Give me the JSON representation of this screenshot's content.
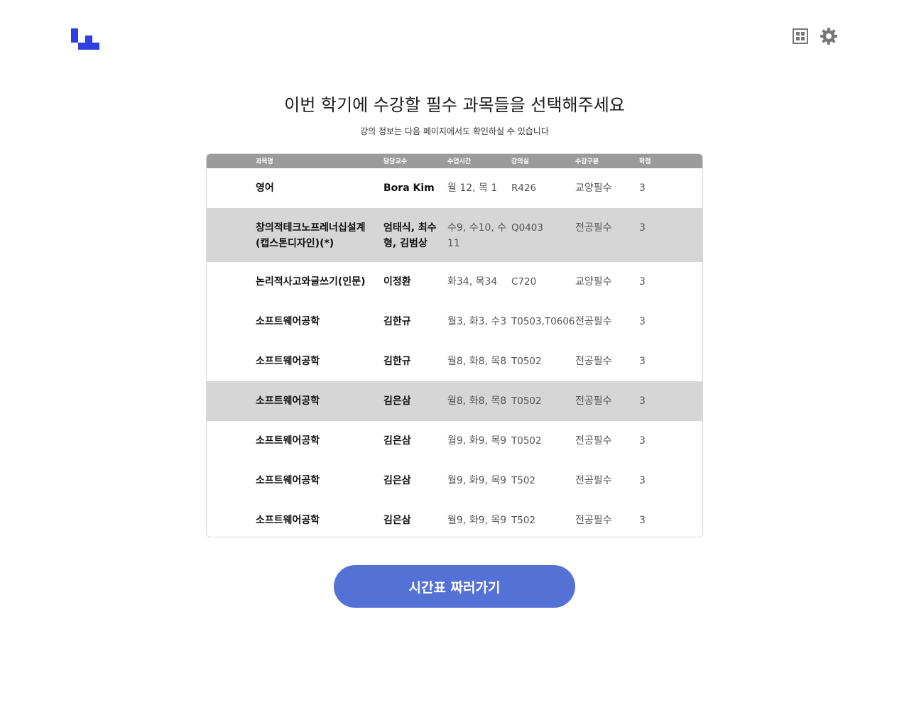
{
  "header": {
    "logo_icon": "app-logo",
    "icons": [
      "grid-view-icon",
      "gear-icon"
    ],
    "accent_color": "#2f3fe0"
  },
  "page": {
    "title": "이번 학기에 수강할 필수 과목들을 선택해주세요",
    "subtitle": "강의 정보는 다음 페이지에서도 확인하실 수 있습니다"
  },
  "table": {
    "columns": [
      "과목명",
      "담당교수",
      "수업시간",
      "강의실",
      "수강구분",
      "학점"
    ],
    "rows": [
      {
        "name": "영어",
        "professor": "Bora Kim",
        "time": "월 12, 목 1",
        "room": "R426",
        "type": "교양필수",
        "credits": "3",
        "selected": false
      },
      {
        "name": "창의적테크노프레너십설계(캡스톤디자인)(*)",
        "professor": "엄태식, 최수형, 김범상",
        "time": "수9, 수10, 수11",
        "room": "Q0403",
        "type": "전공필수",
        "credits": "3",
        "selected": true
      },
      {
        "name": "논리적사고와글쓰기(인문)",
        "professor": "이정환",
        "time": "화34, 목34",
        "room": "C720",
        "type": "교양필수",
        "credits": "3",
        "selected": false
      },
      {
        "name": "소프트웨어공학",
        "professor": "김한규",
        "time": "월3, 화3, 수3",
        "room": "T0503,T0606",
        "type": "전공필수",
        "credits": "3",
        "selected": false
      },
      {
        "name": "소프트웨어공학",
        "professor": "김한규",
        "time": "월8, 화8, 목8",
        "room": "T0502",
        "type": "전공필수",
        "credits": "3",
        "selected": false
      },
      {
        "name": "소프트웨어공학",
        "professor": "김은삼",
        "time": "월8, 화8, 목8",
        "room": "T0502",
        "type": "전공필수",
        "credits": "3",
        "selected": true
      },
      {
        "name": "소프트웨어공학",
        "professor": "김은삼",
        "time": "월9, 화9, 목9",
        "room": "T0502",
        "type": "전공필수",
        "credits": "3",
        "selected": false
      },
      {
        "name": "소프트웨어공학",
        "professor": "김은삼",
        "time": "월9, 화9, 목9",
        "room": "T502",
        "type": "전공필수",
        "credits": "3",
        "selected": false
      },
      {
        "name": "소프트웨어공학",
        "professor": "김은삼",
        "time": "월9, 화9, 목9",
        "room": "T502",
        "type": "전공필수",
        "credits": "3",
        "selected": false
      }
    ]
  },
  "cta": {
    "label": "시간표 짜러가기",
    "color": "#5472d6"
  }
}
